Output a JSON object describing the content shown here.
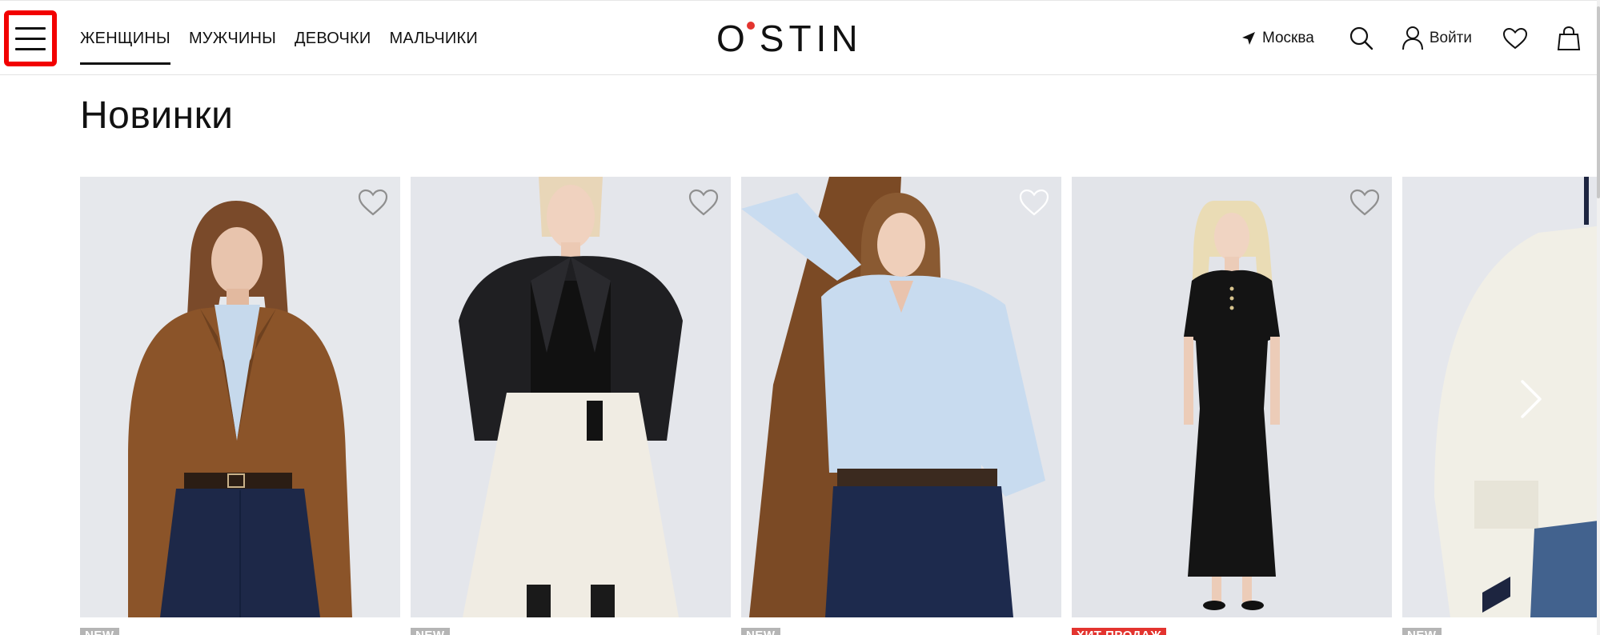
{
  "header": {
    "nav": [
      {
        "label": "ЖЕНЩИНЫ",
        "active": true
      },
      {
        "label": "МУЖЧИНЫ",
        "active": false
      },
      {
        "label": "ДЕВОЧКИ",
        "active": false
      },
      {
        "label": "МАЛЬЧИКИ",
        "active": false
      }
    ],
    "logo": {
      "first": "O",
      "rest": "STIN",
      "dot_color": "#e3342f"
    },
    "city": "Москва",
    "login": "Войти"
  },
  "main": {
    "title": "Новинки",
    "products": [
      {
        "badge": "NEW",
        "badge_color": "#b5b5b5",
        "image_desc": "model-brown-suede-jacket"
      },
      {
        "badge": "NEW",
        "badge_color": "#b5b5b5",
        "image_desc": "model-black-leather-jacket-white-skirt"
      },
      {
        "badge": "NEW",
        "badge_color": "#b5b5b5",
        "image_desc": "model-light-blue-shirt-jeans"
      },
      {
        "badge": "ХИТ ПРОДАЖ",
        "badge_color": "#e3342f",
        "image_desc": "model-black-knit-dress"
      },
      {
        "badge": "NEW",
        "badge_color": "#b5b5b5",
        "image_desc": "model-white-cardigan"
      }
    ]
  },
  "colors": {
    "accent_red": "#e3342f",
    "highlight_border": "#f20000",
    "card_bg": "#e7e9ee"
  }
}
